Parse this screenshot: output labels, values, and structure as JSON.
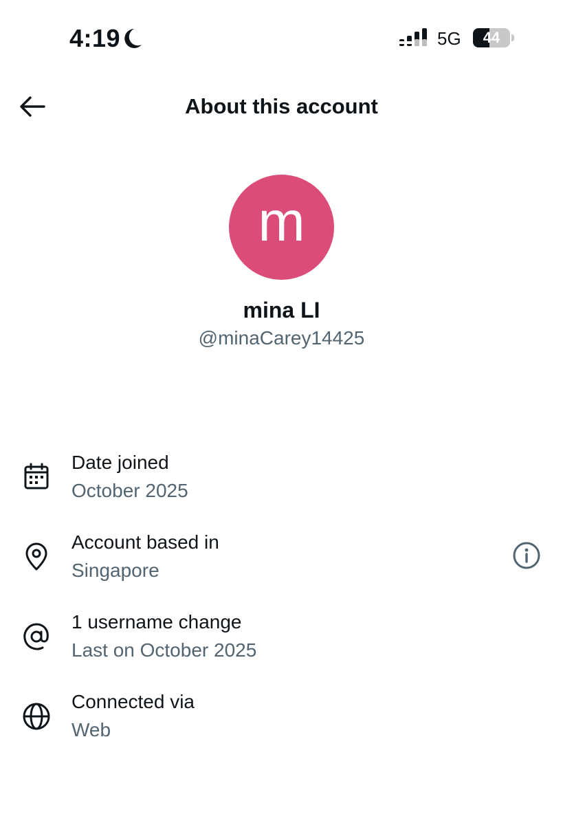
{
  "status_bar": {
    "time": "4:19",
    "network": "5G",
    "battery_level": "44",
    "battery_fraction": 0.44,
    "icons": [
      "moon-icon",
      "signal-icon"
    ]
  },
  "header": {
    "title": "About this account",
    "back_icon": "back-arrow-icon"
  },
  "profile": {
    "avatar_letter": "m",
    "avatar_color": "#dc4c78",
    "display_name": "mina LI",
    "handle": "@minaCarey14425"
  },
  "details": [
    {
      "icon": "calendar-icon",
      "title": "Date joined",
      "value": "October 2025"
    },
    {
      "icon": "location-pin-icon",
      "title": "Account based in",
      "value": "Singapore",
      "action_icon": "info-icon"
    },
    {
      "icon": "at-sign-icon",
      "title": "1 username change",
      "value": "Last on October 2025"
    },
    {
      "icon": "globe-icon",
      "title": "Connected via",
      "value": "Web"
    }
  ],
  "colors": {
    "text_primary": "#0f1419",
    "text_secondary": "#536471",
    "background": "#ffffff"
  }
}
